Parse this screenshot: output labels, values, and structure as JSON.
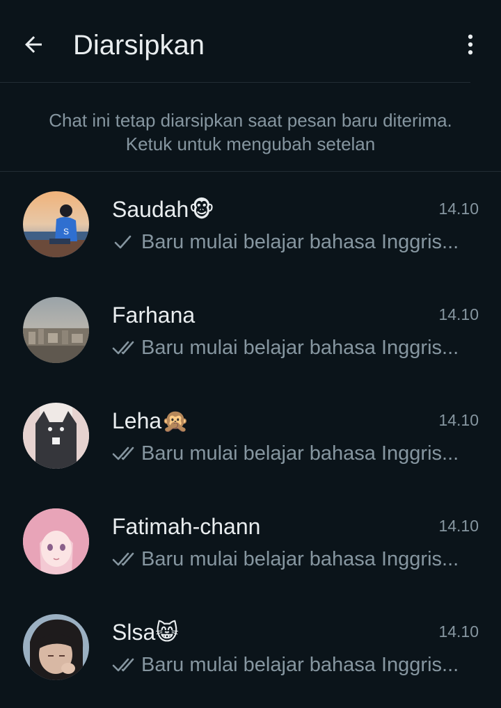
{
  "header": {
    "title": "Diarsipkan",
    "back_icon": "arrow-left-icon",
    "menu_icon": "more-vertical-icon"
  },
  "notice": {
    "line1": "Chat ini tetap diarsipkan saat pesan baru diterima.",
    "line2": "Ketuk untuk mengubah setelan"
  },
  "chats": [
    {
      "name": "Saudah🐵",
      "time": "14.10",
      "preview": "Baru mulai belajar bahasa Inggris...",
      "status": "single-tick-icon"
    },
    {
      "name": "Farhana",
      "time": "14.10",
      "preview": "Baru mulai belajar bahasa Inggris...",
      "status": "double-tick-icon"
    },
    {
      "name": "Leha🙊",
      "time": "14.10",
      "preview": "Baru mulai belajar bahasa Inggris...",
      "status": "double-tick-icon"
    },
    {
      "name": "Fatimah-chann",
      "time": "14.10",
      "preview": "Baru mulai belajar bahasa Inggris...",
      "status": "double-tick-icon"
    },
    {
      "name": "Slsa😸",
      "time": "14.10",
      "preview": "Baru mulai belajar bahasa Inggris...",
      "status": "double-tick-icon"
    }
  ],
  "colors": {
    "background": "#0b141a",
    "primary_text": "#e9edef",
    "secondary_text": "#8696a0",
    "divider": "#222d34"
  }
}
